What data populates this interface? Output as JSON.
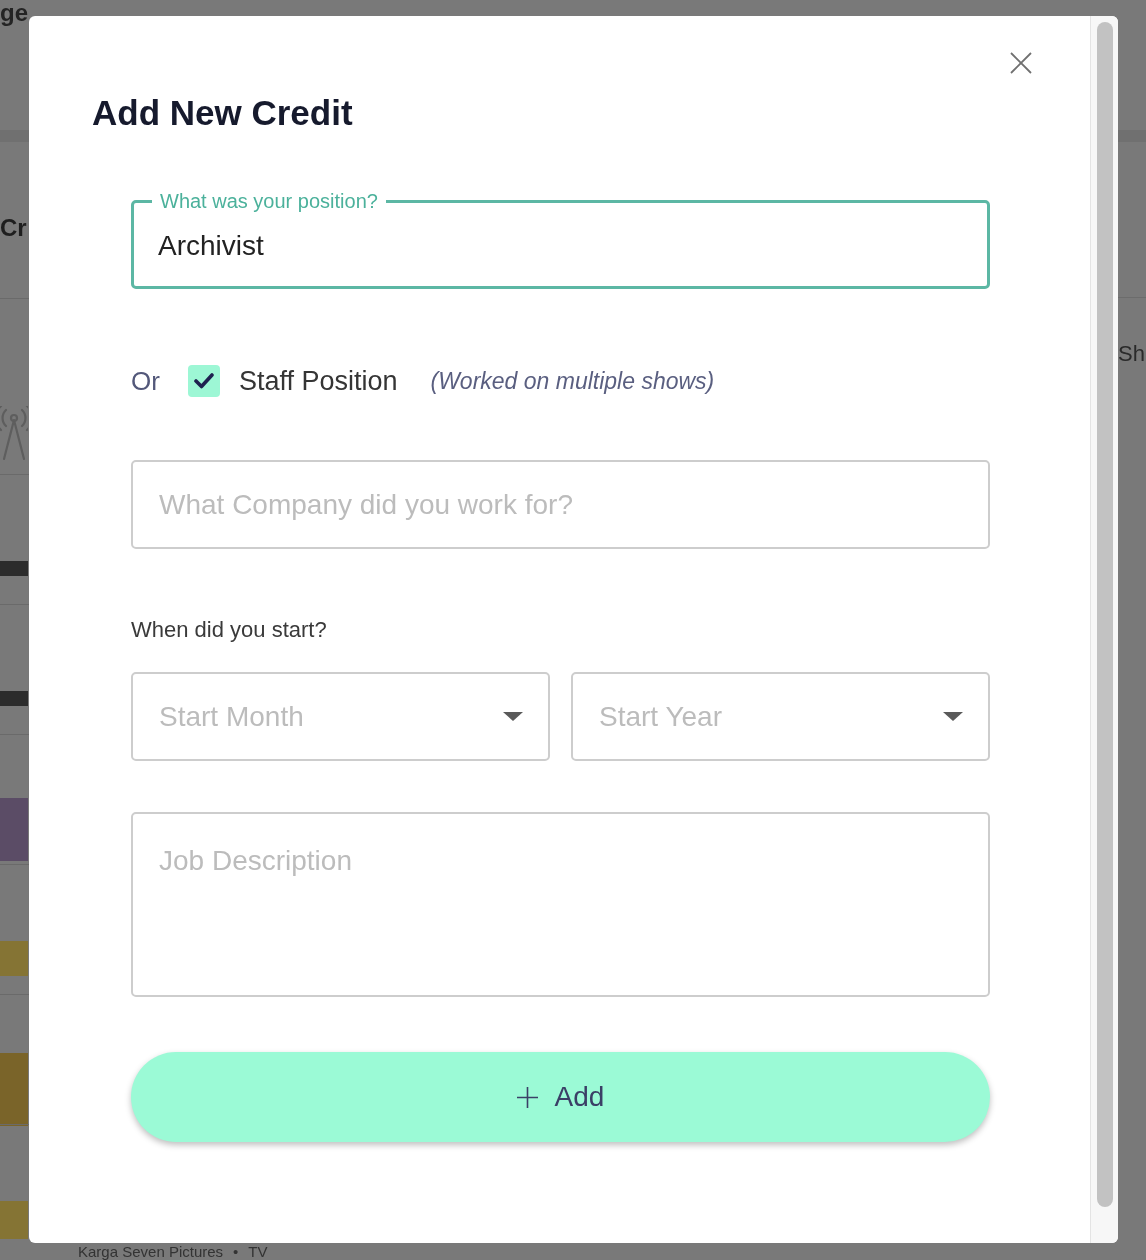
{
  "background_page": {
    "heading": "ge",
    "section_title": "Cr",
    "column_heading": "Sh",
    "credit_line": {
      "company": "Karga Seven Pictures",
      "separator": "•",
      "medium": "TV"
    }
  },
  "dialog": {
    "title": "Add New Credit",
    "position_field": {
      "label": "What was your position?",
      "value": "Archivist",
      "focused": true
    },
    "staff_option": {
      "prefix": "Or",
      "label": "Staff Position",
      "note": "(Worked on multiple shows)",
      "checked": true
    },
    "company_field": {
      "placeholder": "What Company did you work for?"
    },
    "start_label": "When did you start?",
    "selects": [
      {
        "placeholder": "Start Month"
      },
      {
        "placeholder": "Start Year"
      }
    ],
    "description_field": {
      "placeholder": "Job Description"
    },
    "add_button": {
      "label": "Add"
    }
  }
}
